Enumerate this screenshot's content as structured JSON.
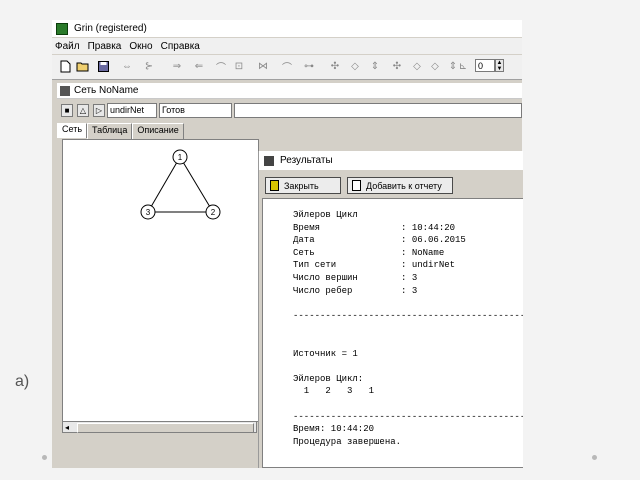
{
  "app": {
    "title": "Grin (registered)",
    "menu": [
      "Файл",
      "Правка",
      "Окно",
      "Справка"
    ],
    "zoom_value": "0"
  },
  "network_window": {
    "title": "Сеть NoName",
    "net_type": "undirNet",
    "status": "Готов",
    "tabs": [
      "Сеть",
      "Таблица",
      "Описание"
    ],
    "graph": {
      "vertices": [
        {
          "label": "1"
        },
        {
          "label": "2"
        },
        {
          "label": "3"
        }
      ]
    }
  },
  "results_window": {
    "title": "Результаты",
    "close_label": "Закрыть",
    "add_label": "Добавить к отчету",
    "log_lines": [
      "Эйлеров Цикл",
      "Время               : 10:44:20",
      "Дата                : 06.06.2015",
      "Сеть                : NoName",
      "Тип сети            : undirNet",
      "Число вершин        : 3",
      "Число ребер         : 3",
      "",
      "----------------------------------------------",
      "",
      "",
      "Источник = 1",
      "",
      "Эйлеров Цикл:",
      "  1   2   3   1",
      "",
      "----------------------------------------------",
      "Время: 10:44:20",
      "Процедура завершена."
    ]
  },
  "slide_label": "а)",
  "colors": {
    "window_bg": "#d4d0c8",
    "page_bg": "#f3f3f3"
  },
  "icons": [
    "app-icon",
    "new-file-icon",
    "open-folder-icon",
    "save-icon",
    "network-icon",
    "results-icon",
    "close-door-icon",
    "add-report-icon"
  ]
}
